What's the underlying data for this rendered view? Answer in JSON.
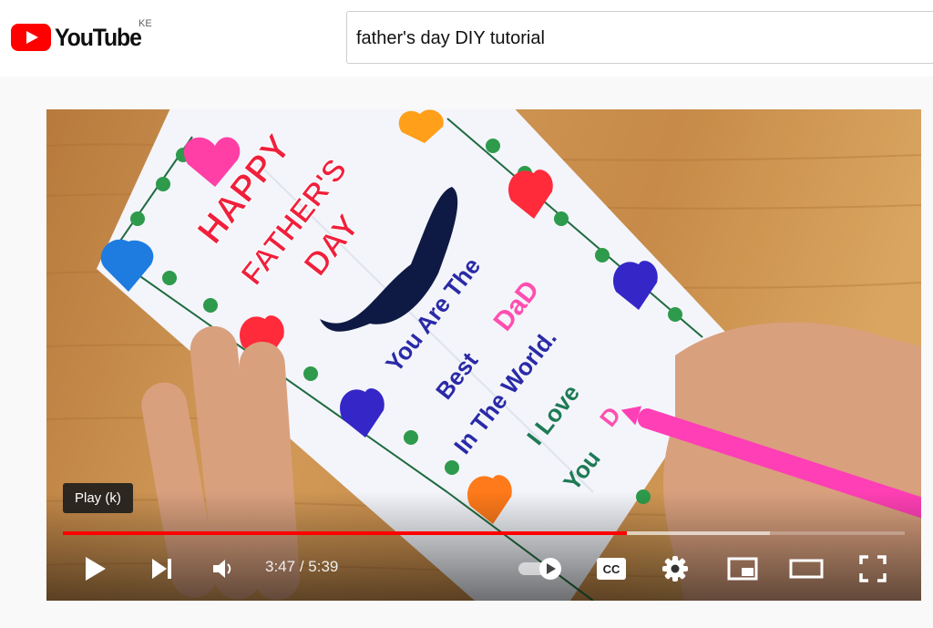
{
  "header": {
    "logo_text": "YouTube",
    "country_code": "KE",
    "search_value": "father's day DIY tutorial"
  },
  "player": {
    "tooltip": "Play (k)",
    "current_time": "3:47",
    "separator": " / ",
    "duration": "5:39",
    "progress_fraction": 0.6696,
    "buffered_fraction": 0.84,
    "colors": {
      "played": "#ff0000",
      "brand": "#ff0000"
    },
    "controls": [
      "play-icon",
      "next-icon",
      "volume-icon",
      "autoplay-toggle",
      "subtitles-icon",
      "settings-icon",
      "miniplayer-icon",
      "theater-mode-icon",
      "fullscreen-icon"
    ]
  },
  "thumbnail": {
    "card_title": [
      "HAPPY",
      "FATHER'S",
      "DAY"
    ],
    "card_message": [
      "You Are The",
      "Best",
      "DaD",
      "In The World.",
      "I Love",
      "You",
      "D"
    ]
  }
}
